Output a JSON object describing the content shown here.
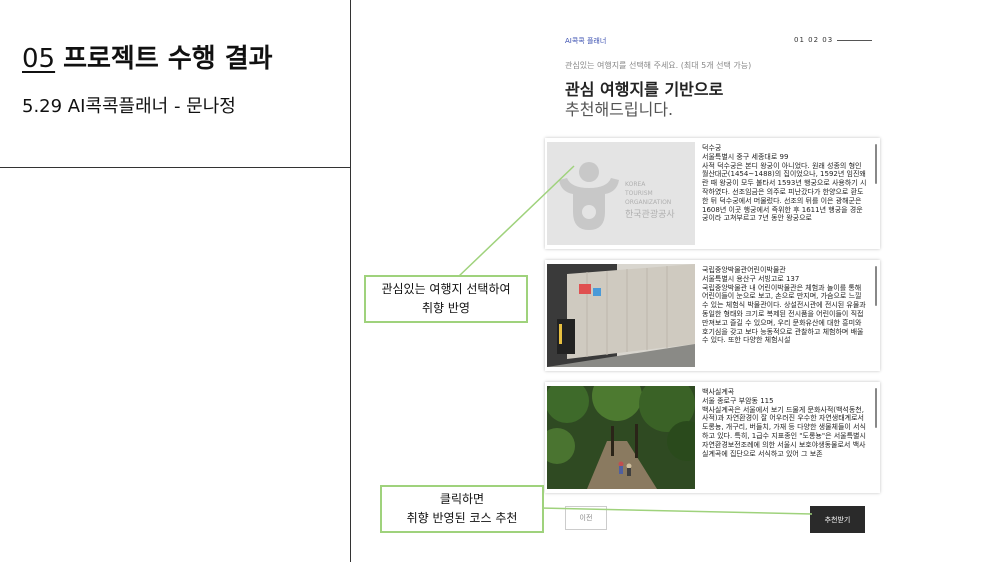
{
  "slide": {
    "title_number": "05",
    "title_text": "프로젝트 수행 결과",
    "subtitle": "5.29 AI콕콕플래너 - 문나정"
  },
  "app": {
    "brand": "AI콕콕 플래너",
    "steps": "01  02  03",
    "hint": "관심있는 여행지를 선택해 주세요. (최대 5개 선택 가능)",
    "heading_line1": "관심 여행지를 기반으로",
    "heading_line2": "추천해드립니다.",
    "cards": [
      {
        "image_text": [
          "KOREA",
          "TOURISM",
          "ORGANIZATION",
          "한국관광공사"
        ],
        "name": "덕수궁",
        "address": "서울특별시 중구 세종대로 99",
        "description": "사적 덕수궁은 본디 왕궁이 아니었다. 원래 성종의 형인 월산대군(1454~1488)의 집이었으나, 1592년 임진왜란 때 왕궁이 모두 불타서 1593년 행궁으로 사용하기 시작하였다. 선조임금은 의주로 피난갔다가 한양으로 환도한 뒤 덕수궁에서 머물렀다. 선조의 뒤를 이은 광해군은 1608년 이곳 행궁에서 즉위한 후 1611년 행궁을 경운궁이라 고쳐부르고 7년 동안 왕궁으로"
      },
      {
        "name": "국립중앙박물관어린이박물관",
        "address": "서울특별시 용산구 서빙고로 137",
        "description": "국립중앙박물관 내 어린이박물관은 체험과 놀이를 통해 어린이들이 눈으로 보고, 손으로 만지며, 가슴으로 느낄 수 있는 체험식 박물관이다. 상설전시관에 전시된 유물과 동일한 형태와 크기로 복제된 전시품을 어린이들이 직접 만져보고 즐길 수 있으며, 우리 문화유산에 대한 흥미와 호기심을 갖고 보다 능동적으로 관찰하고 체험하며 배울 수 있다. 또한 다양한 체험시설"
      },
      {
        "name": "백사실계곡",
        "address": "서울 종로구 부암동 115",
        "description": "백사실계곡은 서울에서 보기 드물게 문화사적(백석동천, 사적)과 자연환경이 잘 어우러진 우수한 자연생태계로서 도롱뇽, 개구리, 버들치, 가재 등 다양한 생물체들이 서식하고 있다. 특히, 1급수 지표종인 \"도롱뇽\"은 서울특별시자연환경보전조례에 의한 서울시 보호야생동물로서 백사실계곡에 집단으로 서식하고 있어 그 보존"
      }
    ],
    "prev_button": "이전",
    "next_button": "추천받기"
  },
  "callouts": {
    "select": [
      "관심있는 여행지 선택하여",
      "취향 반영"
    ],
    "recommend": [
      "클릭하면",
      "취향 반영된 코스 추천"
    ]
  },
  "colors": {
    "callout_border": "#9fd27c",
    "brand_text": "#3a4fb0",
    "button_dark": "#2a2a2a"
  }
}
